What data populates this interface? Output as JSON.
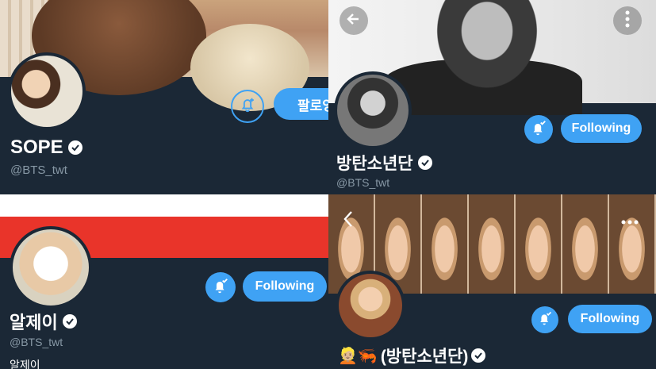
{
  "panel1": {
    "name": "SOPE",
    "handle": "@BTS_twt",
    "follow_button": "팔로잉"
  },
  "panel2": {
    "name": "방탄소년단",
    "handle": "@BTS_twt",
    "following_button": "Following"
  },
  "panel3": {
    "name": "알제이",
    "handle": "@BTS_twt",
    "following_button": "Following",
    "bio": "알제이"
  },
  "panel4": {
    "name": "(방탄소년단)",
    "following_button": "Following",
    "emoji_prefix": "👱🏼🦐"
  },
  "colors": {
    "background": "#1b2836",
    "accent": "#3fa2f4",
    "handle": "#8899a6",
    "banner_red": "#e9342a"
  },
  "icons": [
    "bell-plus-icon",
    "bell-check-icon",
    "back-arrow-icon",
    "more-vertical-icon",
    "more-horizontal-icon",
    "verified-badge-icon"
  ]
}
